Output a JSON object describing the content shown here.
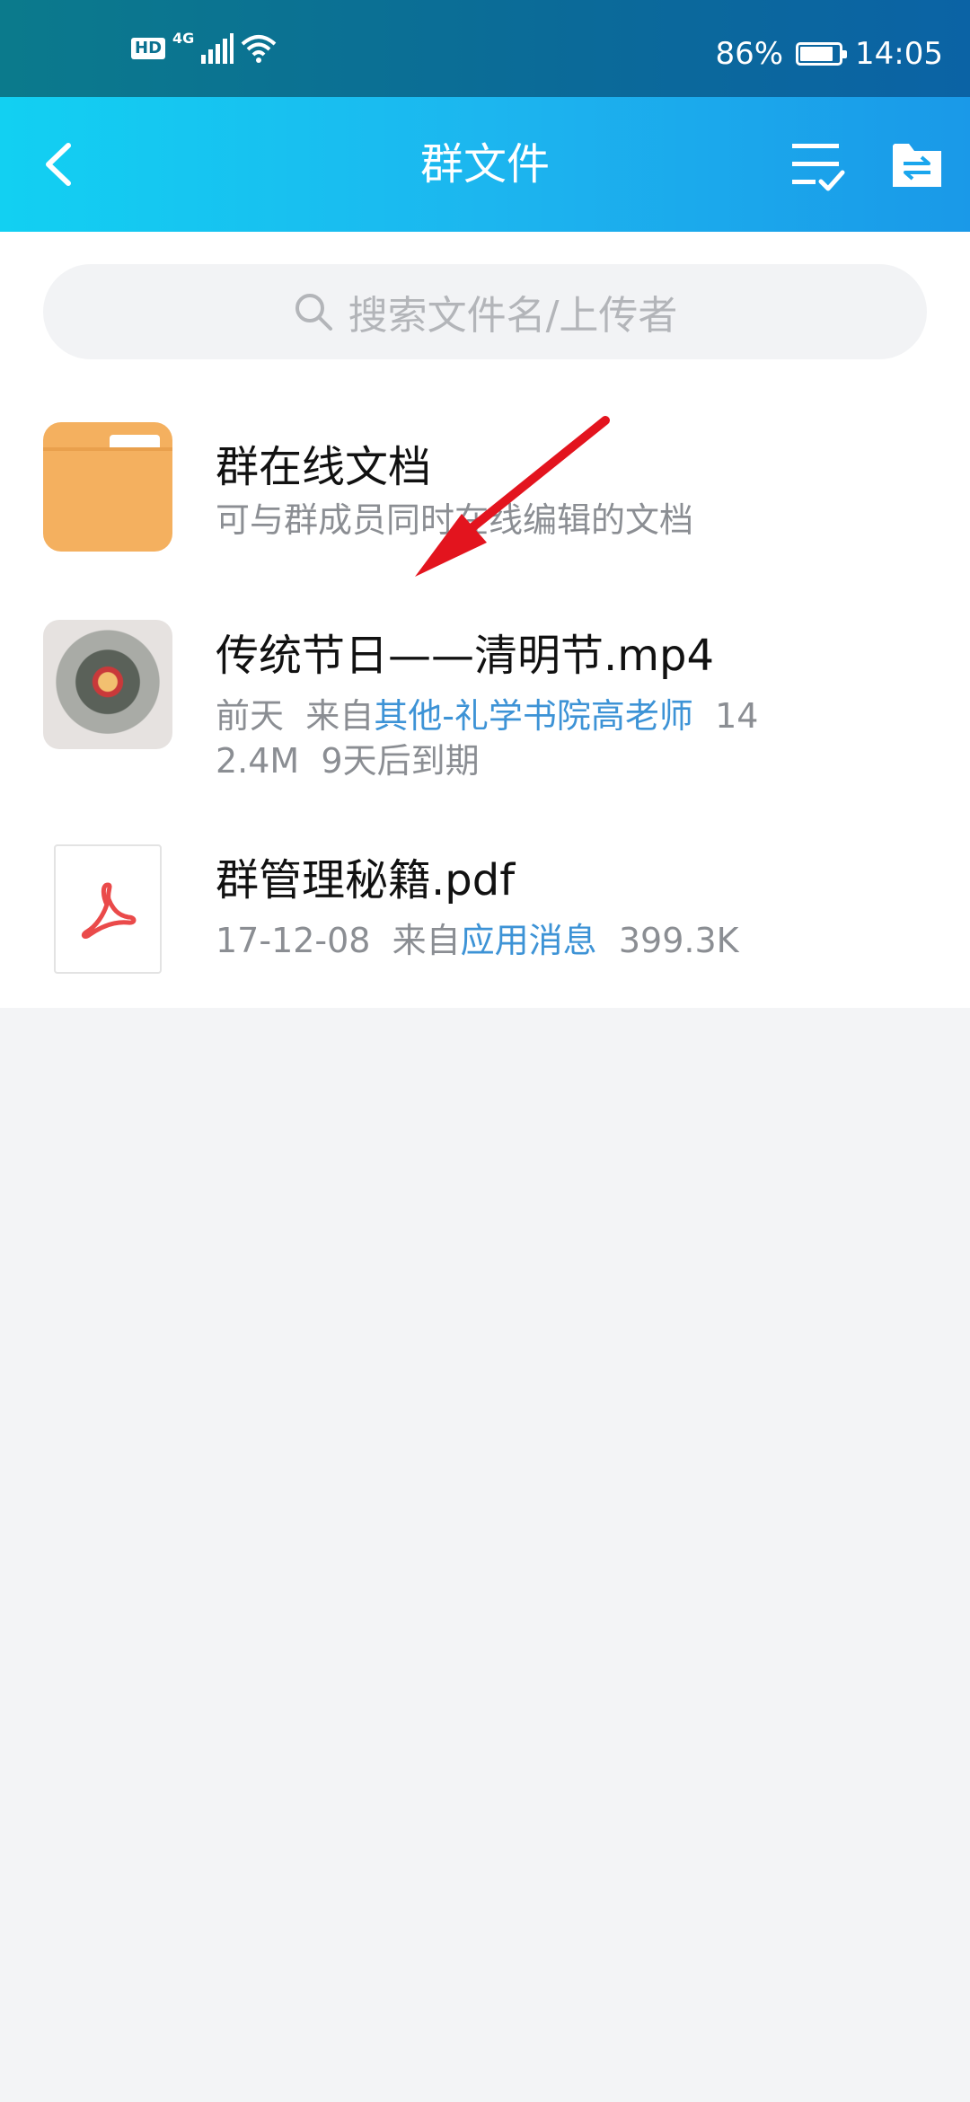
{
  "status_bar": {
    "hd": "HD",
    "network": "4G",
    "battery": "86%",
    "battery_level": 0.86,
    "time": "14:05"
  },
  "header": {
    "title": "群文件",
    "back_icon": "chevron-left-icon",
    "multi_select_icon": "list-check-icon",
    "transfer_icon": "folder-transfer-icon"
  },
  "search": {
    "placeholder": "搜索文件名/上传者"
  },
  "files": [
    {
      "name": "群在线文档",
      "subtitle": "可与群成员同时在线编辑的文档",
      "icon": "folder-icon"
    },
    {
      "name": "传统节日——清明节.mp4",
      "meta_date": "前天",
      "meta_from_prefix": "来自",
      "meta_source": "其他-礼学书院高老师",
      "meta_size_line1": "14",
      "meta_size_line2": "2.4M",
      "meta_expiry": "9天后到期",
      "icon": "video-thumbnail"
    },
    {
      "name": "群管理秘籍.pdf",
      "meta_date": "17-12-08",
      "meta_from_prefix": "来自",
      "meta_source": "应用消息",
      "meta_size": "399.3K",
      "icon": "pdf-icon"
    }
  ],
  "colors": {
    "header_gradient_start": "#12d0f2",
    "header_gradient_end": "#1a99e8",
    "link": "#3d93d6",
    "folder": "#f4b05f",
    "annotation_arrow": "#e3141e"
  }
}
